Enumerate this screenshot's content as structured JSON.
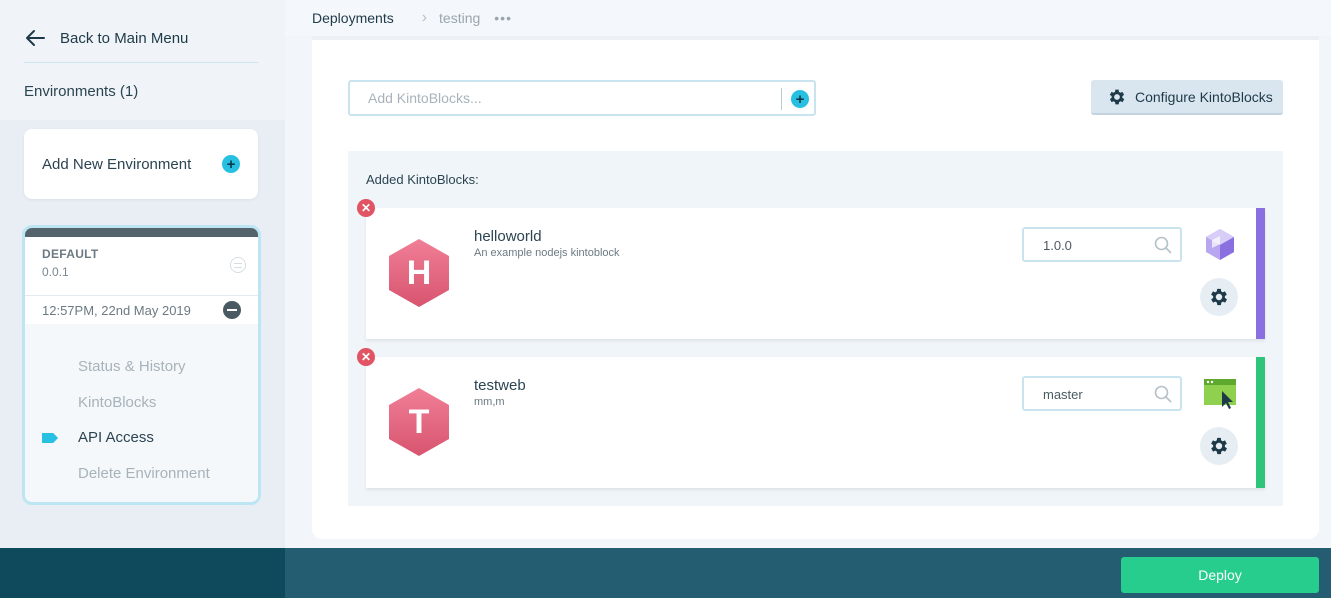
{
  "sidebar": {
    "back_label": "Back to Main Menu",
    "environments_title": "Environments (1)",
    "add_environment_label": "Add New Environment",
    "environment": {
      "name": "DEFAULT",
      "version": "0.0.1",
      "timestamp": "12:57PM, 22nd May 2019",
      "menu": [
        {
          "label": "Status & History",
          "active": false
        },
        {
          "label": "KintoBlocks",
          "active": false
        },
        {
          "label": "API Access",
          "active": true
        },
        {
          "label": "Delete Environment",
          "active": false
        }
      ]
    }
  },
  "breadcrumb": {
    "root": "Deployments",
    "current": "testing",
    "more": "•••"
  },
  "main": {
    "search_placeholder": "Add KintoBlocks...",
    "configure_label": "Configure KintoBlocks",
    "added_title": "Added KintoBlocks:",
    "kintoblocks": [
      {
        "letter": "H",
        "name": "helloworld",
        "description": "An example nodejs kintoblock",
        "version": "1.0.0",
        "type_icon": "cube-icon",
        "accent": "#8a6fe0"
      },
      {
        "letter": "T",
        "name": "testweb",
        "description": "mm,m",
        "version": "master",
        "type_icon": "browser-cursor-icon",
        "accent": "#2ec47a"
      }
    ]
  },
  "footer": {
    "deploy_label": "Deploy"
  },
  "colors": {
    "accent_cyan": "#27c0e3",
    "deploy_green": "#26cd8c",
    "footer_dark": "#0f4a5c",
    "footer": "#245d72",
    "hex_pink": "#e06381"
  }
}
